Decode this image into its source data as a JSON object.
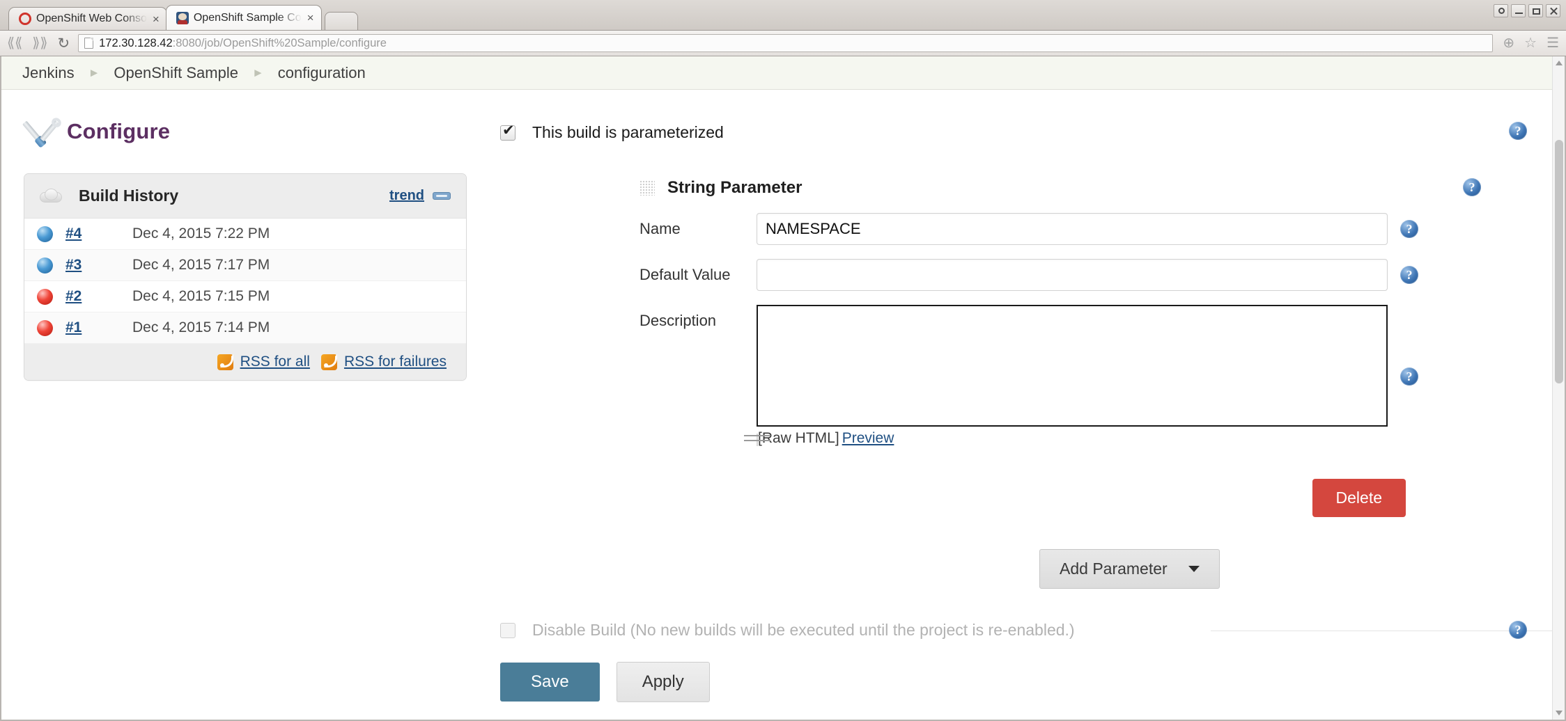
{
  "browser": {
    "tabs": [
      {
        "title": "OpenShift Web Conso",
        "favicon": "openshift-icon",
        "active": false
      },
      {
        "title": "OpenShift Sample Co",
        "favicon": "jenkins-icon",
        "active": true
      }
    ],
    "new_tab_label": "",
    "url_host": "172.30.128.42",
    "url_rest": ":8080/job/OpenShift%20Sample/configure",
    "nav": {
      "back": "⋘",
      "forward": "⋙",
      "reload": "⟳",
      "zoom": "⊕",
      "bookmark": "☆",
      "menu": "☰"
    },
    "window_controls": {
      "user": "user-icon",
      "minimize": "minimize-icon",
      "maximize": "maximize-icon",
      "close": "close-icon"
    }
  },
  "breadcrumbs": [
    {
      "label": "Jenkins"
    },
    {
      "label": "OpenShift Sample"
    },
    {
      "label": "configuration"
    }
  ],
  "page": {
    "title": "Configure",
    "title_icon": "tools-icon"
  },
  "build_history": {
    "heading": "Build History",
    "heading_icon": "cloud-icon",
    "trend_label": "trend",
    "collapse_icon": "collapse-bar-icon",
    "builds": [
      {
        "status": "blue",
        "number": "#4",
        "date": "Dec 4, 2015 7:22 PM"
      },
      {
        "status": "blue",
        "number": "#3",
        "date": "Dec 4, 2015 7:17 PM"
      },
      {
        "status": "red",
        "number": "#2",
        "date": "Dec 4, 2015 7:15 PM"
      },
      {
        "status": "red",
        "number": "#1",
        "date": "Dec 4, 2015 7:14 PM"
      }
    ],
    "rss_all": "RSS for all",
    "rss_failures": "RSS for failures"
  },
  "form": {
    "parameterized_label": "This build is parameterized",
    "parameterized_checked": true,
    "parameter": {
      "type_title": "String Parameter",
      "name_label": "Name",
      "name_value": "NAMESPACE",
      "default_label": "Default Value",
      "default_value": "",
      "description_label": "Description",
      "description_value": "",
      "raw_html_label": "[Raw HTML]",
      "preview_label": "Preview",
      "delete_label": "Delete"
    },
    "add_parameter_label": "Add Parameter",
    "disable_build_label": "Disable Build (No new builds will be executed until the project is re-enabled.)",
    "disable_build_checked": false,
    "save_label": "Save",
    "apply_label": "Apply",
    "help_label": "?"
  },
  "colors": {
    "title_purple": "#5c2f62",
    "link_blue": "#1f4f82",
    "save_blue": "#4a7d98",
    "delete_red": "#d4473e",
    "build_success": "#4a9ad4",
    "build_failure": "#ef4438"
  }
}
